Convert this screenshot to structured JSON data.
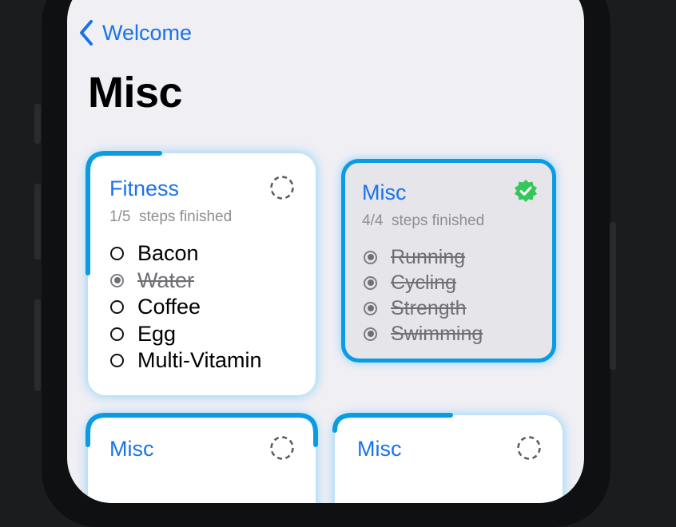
{
  "nav": {
    "back_label": "Welcome"
  },
  "page": {
    "title": "Misc"
  },
  "cards": [
    {
      "title": "Fitness",
      "completed": 1,
      "total": 5,
      "progress_count": "1/5",
      "progress_text": "steps finished",
      "status": "incomplete",
      "steps": [
        {
          "label": "Bacon",
          "done": false
        },
        {
          "label": "Water",
          "done": true
        },
        {
          "label": "Coffee",
          "done": false
        },
        {
          "label": "Egg",
          "done": false
        },
        {
          "label": "Multi-Vitamin",
          "done": false
        }
      ]
    },
    {
      "title": "Misc",
      "completed": 4,
      "total": 4,
      "progress_count": "4/4",
      "progress_text": "steps finished",
      "status": "complete",
      "steps": [
        {
          "label": "Running",
          "done": true
        },
        {
          "label": "Cycling",
          "done": true
        },
        {
          "label": "Strength",
          "done": true
        },
        {
          "label": "Swimming",
          "done": true
        }
      ]
    },
    {
      "title": "Misc",
      "status": "incomplete"
    },
    {
      "title": "Misc",
      "status": "incomplete"
    }
  ],
  "colors": {
    "accent": "#1a73e8",
    "progress_ring": "#0a9be3",
    "complete_badge": "#34c759",
    "secondary_text": "#8e8e93"
  },
  "icons": {
    "back": "chevron-left-icon",
    "incomplete": "dashed-circle-icon",
    "complete": "checkmark-seal-icon"
  }
}
